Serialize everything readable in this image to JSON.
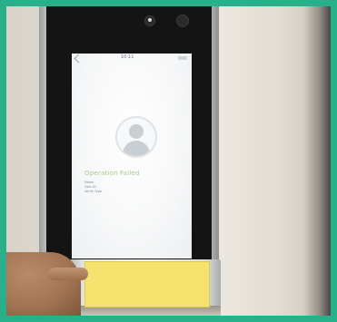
{
  "device": {
    "status_title": "Operation Failed",
    "detail_line_1": "Name",
    "detail_line_2": "User ID",
    "detail_line_3": "Verify Type",
    "clock": "10:11",
    "avatar_icon": "user-silhouette-icon",
    "back_icon": "back-arrow-icon"
  },
  "colors": {
    "frame": "#27b08a",
    "status_title": "#a6c98e",
    "note": "#f6e36f"
  }
}
